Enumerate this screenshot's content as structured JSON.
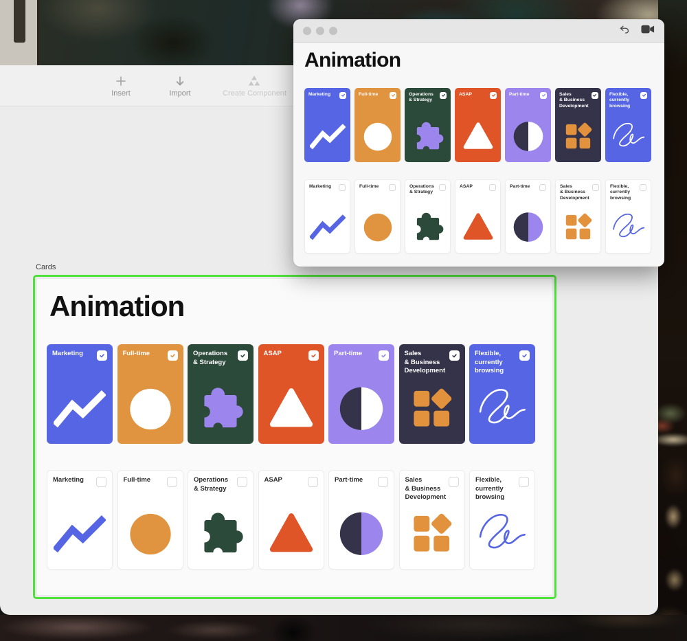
{
  "toolbar": {
    "items": [
      {
        "label": "Insert",
        "icon": "plus-icon",
        "enabled": true
      },
      {
        "label": "Import",
        "icon": "arrow-down-icon",
        "enabled": true
      },
      {
        "label": "Create Component",
        "icon": "component-triangles-icon",
        "enabled": false
      }
    ]
  },
  "preview_window": {
    "title": "Animation",
    "traffic_lights": [
      "close",
      "minimize",
      "zoom"
    ],
    "action_icons": [
      "undo-icon",
      "video-camera-icon"
    ]
  },
  "canvas": {
    "frame_label": "Cards",
    "title": "Animation",
    "selection_color": "#50e23c"
  },
  "cards": [
    {
      "id": "marketing",
      "label": "Marketing",
      "fill": "#5565e4",
      "icon": "trend-line-icon",
      "icon_filled_colors": [
        "#ffffff"
      ],
      "icon_outline_colors": [
        "#5565e4"
      ]
    },
    {
      "id": "full-time",
      "label": "Full-time",
      "fill": "#e1943f",
      "icon": "circle-icon",
      "icon_filled_colors": [
        "#ffffff"
      ],
      "icon_outline_colors": [
        "#e1943f"
      ]
    },
    {
      "id": "operations-strategy",
      "label": "Operations\n& Strategy",
      "fill": "#2c4a3a",
      "icon": "puzzle-icon",
      "icon_filled_colors": [
        "#9c85ec"
      ],
      "icon_outline_colors": [
        "#2c4a3a"
      ]
    },
    {
      "id": "asap",
      "label": "ASAP",
      "fill": "#df5527",
      "icon": "triangle-icon",
      "icon_filled_colors": [
        "#ffffff"
      ],
      "icon_outline_colors": [
        "#df5527"
      ]
    },
    {
      "id": "part-time",
      "label": "Part-time",
      "fill": "#9c85ec",
      "icon": "half-circle-icon",
      "icon_filled_colors": [
        "#353349",
        "#ffffff"
      ],
      "icon_outline_colors": [
        "#353349",
        "#9c85ec"
      ]
    },
    {
      "id": "sales-business-development",
      "label": "Sales\n& Business\nDevelopment",
      "fill": "#353349",
      "icon": "grid-squares-icon",
      "icon_filled_colors": [
        "#e2913c"
      ],
      "icon_outline_colors": [
        "#e2913c"
      ]
    },
    {
      "id": "flexible-currently-browsing",
      "label": "Flexible,\ncurrently\nbrowsing",
      "fill": "#5565e4",
      "icon": "signature-icon",
      "icon_filled_colors": [
        "#ffffff"
      ],
      "icon_outline_colors": [
        "#5565e4"
      ]
    }
  ],
  "rows": {
    "top": {
      "variant": "filled",
      "checked": true
    },
    "bottom": {
      "variant": "outline",
      "checked": false
    }
  }
}
